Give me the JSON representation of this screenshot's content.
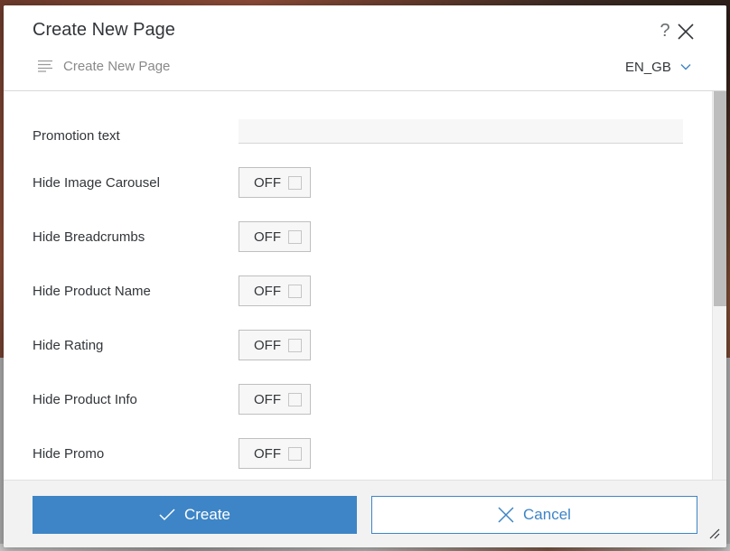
{
  "dialog": {
    "title": "Create New Page",
    "help_symbol": "?",
    "subtitle": "Create New Page",
    "language": "EN_GB"
  },
  "form": {
    "promotion_text": {
      "label": "Promotion text",
      "value": ""
    },
    "toggles": [
      {
        "label": "Hide Image Carousel",
        "state": "OFF"
      },
      {
        "label": "Hide Breadcrumbs",
        "state": "OFF"
      },
      {
        "label": "Hide Product Name",
        "state": "OFF"
      },
      {
        "label": "Hide Rating",
        "state": "OFF"
      },
      {
        "label": "Hide Product Info",
        "state": "OFF"
      },
      {
        "label": "Hide Promo",
        "state": "OFF"
      }
    ]
  },
  "footer": {
    "create_label": "Create",
    "cancel_label": "Cancel"
  },
  "colors": {
    "accent": "#3d85c6",
    "text": "#32363a",
    "muted": "#89898a"
  }
}
